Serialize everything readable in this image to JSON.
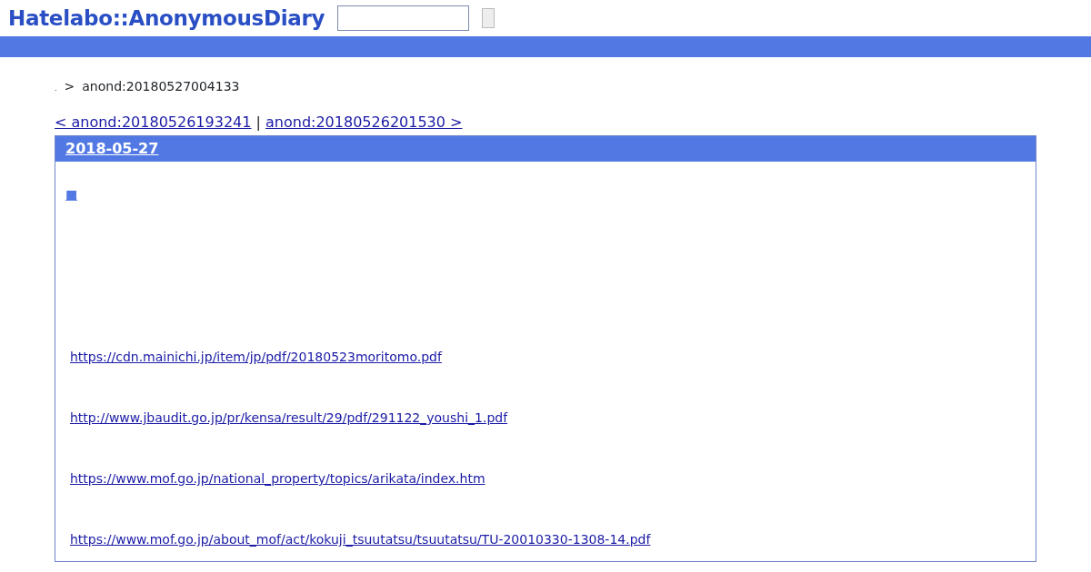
{
  "header": {
    "logo": "Hatelabo::AnonymousDiary"
  },
  "breadcrumb": {
    "home": ".",
    "separator": ">",
    "current": "anond:20180527004133"
  },
  "pager": {
    "prev": "< anond:20180526193241",
    "divider": "|",
    "next": "anond:20180526201530 >"
  },
  "entry": {
    "date": "2018-05-27",
    "marker": "■",
    "links": [
      "https://cdn.mainichi.jp/item/jp/pdf/20180523moritomo.pdf",
      "http://www.jbaudit.go.jp/pr/kensa/result/29/pdf/291122_youshi_1.pdf",
      "https://www.mof.go.jp/national_property/topics/arikata/index.htm",
      "https://www.mof.go.jp/about_mof/act/kokuji_tsuutatsu/tsuutatsu/TU-20010330-1308-14.pdf"
    ]
  }
}
